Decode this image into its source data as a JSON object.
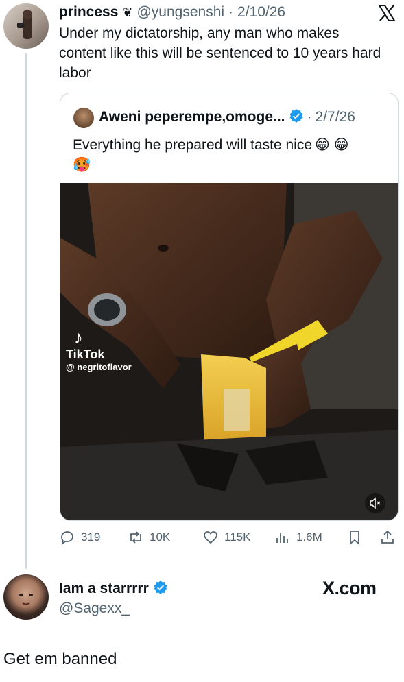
{
  "main_post": {
    "display_name": "princess",
    "handle": "@yungsenshi",
    "separator": "·",
    "date": "2/10/26",
    "text": "Under my dictatorship, any man who makes content like this will be sentenced to 10 years hard labor",
    "name_emoji": "❦",
    "logo_glyph": "X"
  },
  "quoted_post": {
    "display_name": "Aweni peperempe,omoge...",
    "separator": "·",
    "date": "2/7/26",
    "text": "Everything he prepared will taste nice",
    "emojis": "😁 😁",
    "emoji_line2": "🥵",
    "video": {
      "watermark_app": "TikTok",
      "watermark_user": "@ negritoflavor",
      "mute_icon": "volume-muted-icon"
    }
  },
  "actions": {
    "replies": "319",
    "reposts": "10K",
    "likes": "115K",
    "views": "1.6M"
  },
  "reply_author": {
    "display_name": "Iam a starrrrr",
    "handle": "@Sagexx_",
    "site_logo": "X.com"
  },
  "reply_text": "Get em banned",
  "colors": {
    "accent_blue": "#1d9bf0",
    "text_primary": "#0f1419",
    "text_secondary": "#536471",
    "border": "#cfd9de"
  }
}
